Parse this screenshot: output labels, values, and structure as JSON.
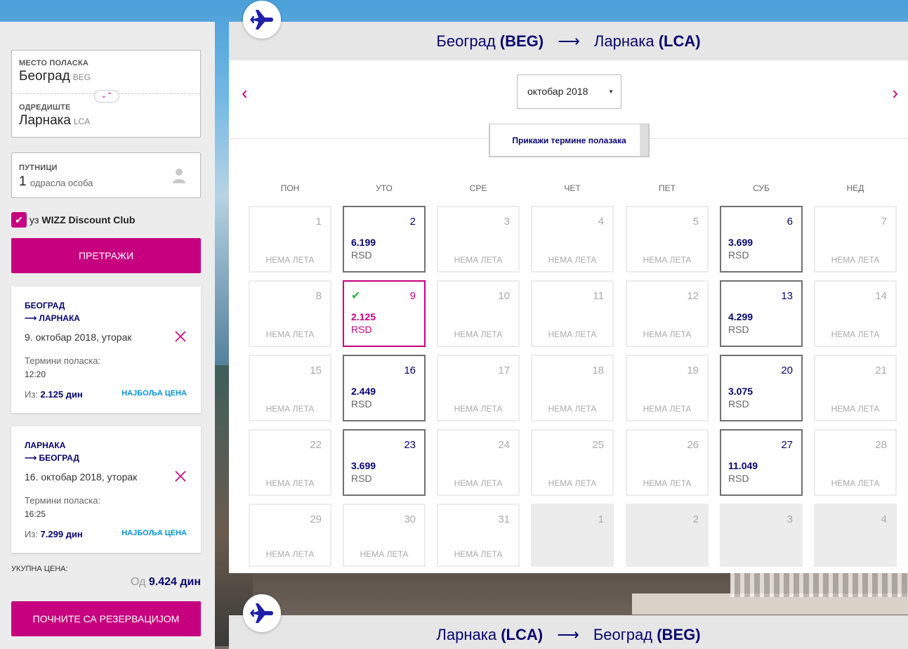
{
  "search": {
    "origin_label": "Место поласка",
    "origin_city": "Београд",
    "origin_code": "BEG",
    "destination_label": "Одредиште",
    "destination_city": "Ларнака",
    "destination_code": "LCA",
    "passengers_label": "Путници",
    "passengers_count": "1",
    "passengers_text": "одрасла особа",
    "wdc_prefix": "уз",
    "wdc_label": "WIZZ Discount Club",
    "search_button": "Претражи"
  },
  "selected_flights": [
    {
      "from": "БЕОГРАД",
      "to": "⟶ ЛАРНАКА",
      "date": "9. октобар 2018, уторак",
      "times_label": "Термини поласка:",
      "time": "12:20",
      "price_prefix": "Из:",
      "price": "2.125 дин",
      "best_price": "НАЈБОЉА ЦЕНА"
    },
    {
      "from": "ЛАРНАКА",
      "to": "⟶ БЕОГРАД",
      "date": "16. октобар 2018, уторак",
      "times_label": "Термини поласка:",
      "time": "16:25",
      "price_prefix": "Из:",
      "price": "7.299 дин",
      "best_price": "НАЈБОЉА ЦЕНА"
    }
  ],
  "total": {
    "label": "УКУПНА ЦЕНА:",
    "prefix": "Од",
    "price": "9.424 дин"
  },
  "book_button": "Почните са резервацијом",
  "outbound": {
    "origin": "Београд",
    "origin_code": "(BEG)",
    "destination": "Ларнака",
    "destination_code": "(LCA)",
    "month": "октобар 2018",
    "show_departures": "Прикажи термине полазака"
  },
  "return": {
    "origin": "Ларнака",
    "origin_code": "(LCA)",
    "destination": "Београд",
    "destination_code": "(BEG)"
  },
  "weekdays": [
    "ПОН",
    "УТО",
    "СРЕ",
    "ЧЕТ",
    "ПЕТ",
    "СУБ",
    "НЕД"
  ],
  "no_flight_label": "НЕМА ЛЕТА",
  "calendar_days": [
    {
      "day": "1",
      "price": null
    },
    {
      "day": "2",
      "price": "6.199",
      "currency": "RSD"
    },
    {
      "day": "3",
      "price": null
    },
    {
      "day": "4",
      "price": null
    },
    {
      "day": "5",
      "price": null
    },
    {
      "day": "6",
      "price": "3.699",
      "currency": "RSD"
    },
    {
      "day": "7",
      "price": null
    },
    {
      "day": "8",
      "price": null
    },
    {
      "day": "9",
      "price": "2.125",
      "currency": "RSD",
      "selected": true
    },
    {
      "day": "10",
      "price": null
    },
    {
      "day": "11",
      "price": null
    },
    {
      "day": "12",
      "price": null
    },
    {
      "day": "13",
      "price": "4.299",
      "currency": "RSD"
    },
    {
      "day": "14",
      "price": null
    },
    {
      "day": "15",
      "price": null
    },
    {
      "day": "16",
      "price": "2.449",
      "currency": "RSD"
    },
    {
      "day": "17",
      "price": null
    },
    {
      "day": "18",
      "price": null
    },
    {
      "day": "19",
      "price": null
    },
    {
      "day": "20",
      "price": "3.075",
      "currency": "RSD"
    },
    {
      "day": "21",
      "price": null
    },
    {
      "day": "22",
      "price": null
    },
    {
      "day": "23",
      "price": "3.699",
      "currency": "RSD"
    },
    {
      "day": "24",
      "price": null
    },
    {
      "day": "25",
      "price": null
    },
    {
      "day": "26",
      "price": null
    },
    {
      "day": "27",
      "price": "11.049",
      "currency": "RSD"
    },
    {
      "day": "28",
      "price": null
    },
    {
      "day": "29",
      "price": null
    },
    {
      "day": "30",
      "price": null
    },
    {
      "day": "31",
      "price": null
    },
    {
      "day": "1",
      "out": true
    },
    {
      "day": "2",
      "out": true
    },
    {
      "day": "3",
      "out": true
    },
    {
      "day": "4",
      "out": true
    }
  ],
  "colors": {
    "accent": "#c6007e",
    "navy": "#06066e",
    "best_price": "#0096d6",
    "check": "#2db24a"
  }
}
